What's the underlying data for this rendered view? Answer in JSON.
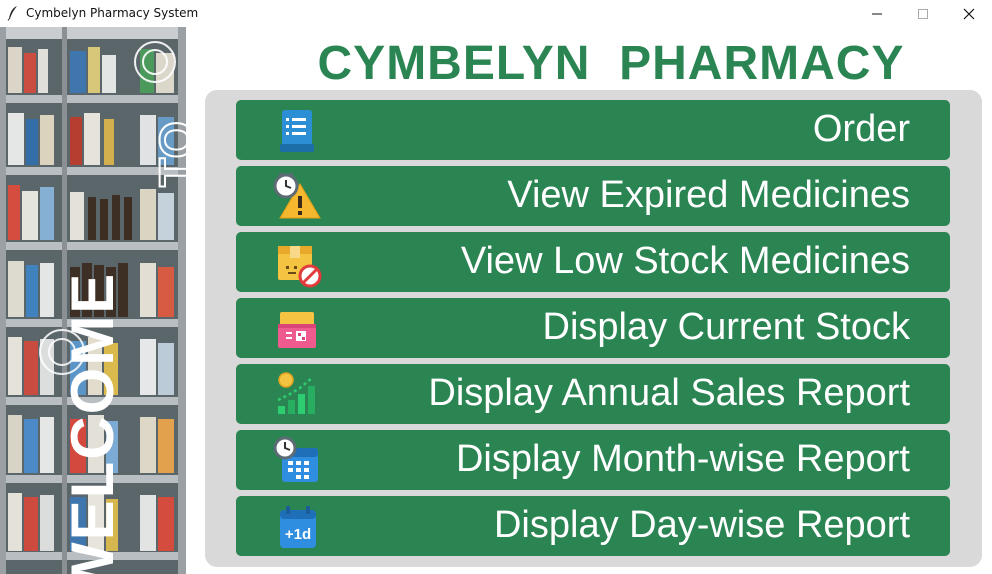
{
  "window": {
    "title": "Cymbelyn Pharmacy System"
  },
  "banner": {
    "welcome": "WELCOME",
    "to": "TO"
  },
  "header": {
    "title": "CYMBELYN  PHARMACY"
  },
  "colors": {
    "accent": "#2a8553",
    "panel": "#d9d9d9"
  },
  "menu": {
    "items": [
      {
        "label": "Order",
        "icon": "order-list-icon"
      },
      {
        "label": "View Expired Medicines",
        "icon": "expired-warning-icon"
      },
      {
        "label": "View Low Stock Medicines",
        "icon": "low-stock-box-icon"
      },
      {
        "label": "Display Current Stock",
        "icon": "stock-box-icon"
      },
      {
        "label": "Display Annual Sales Report",
        "icon": "sales-chart-icon"
      },
      {
        "label": "Display Month-wise Report",
        "icon": "calendar-clock-icon"
      },
      {
        "label": "Display Day-wise Report",
        "icon": "calendar-plus-one-day-icon"
      }
    ]
  },
  "icons": {
    "day_badge": "+1d"
  }
}
